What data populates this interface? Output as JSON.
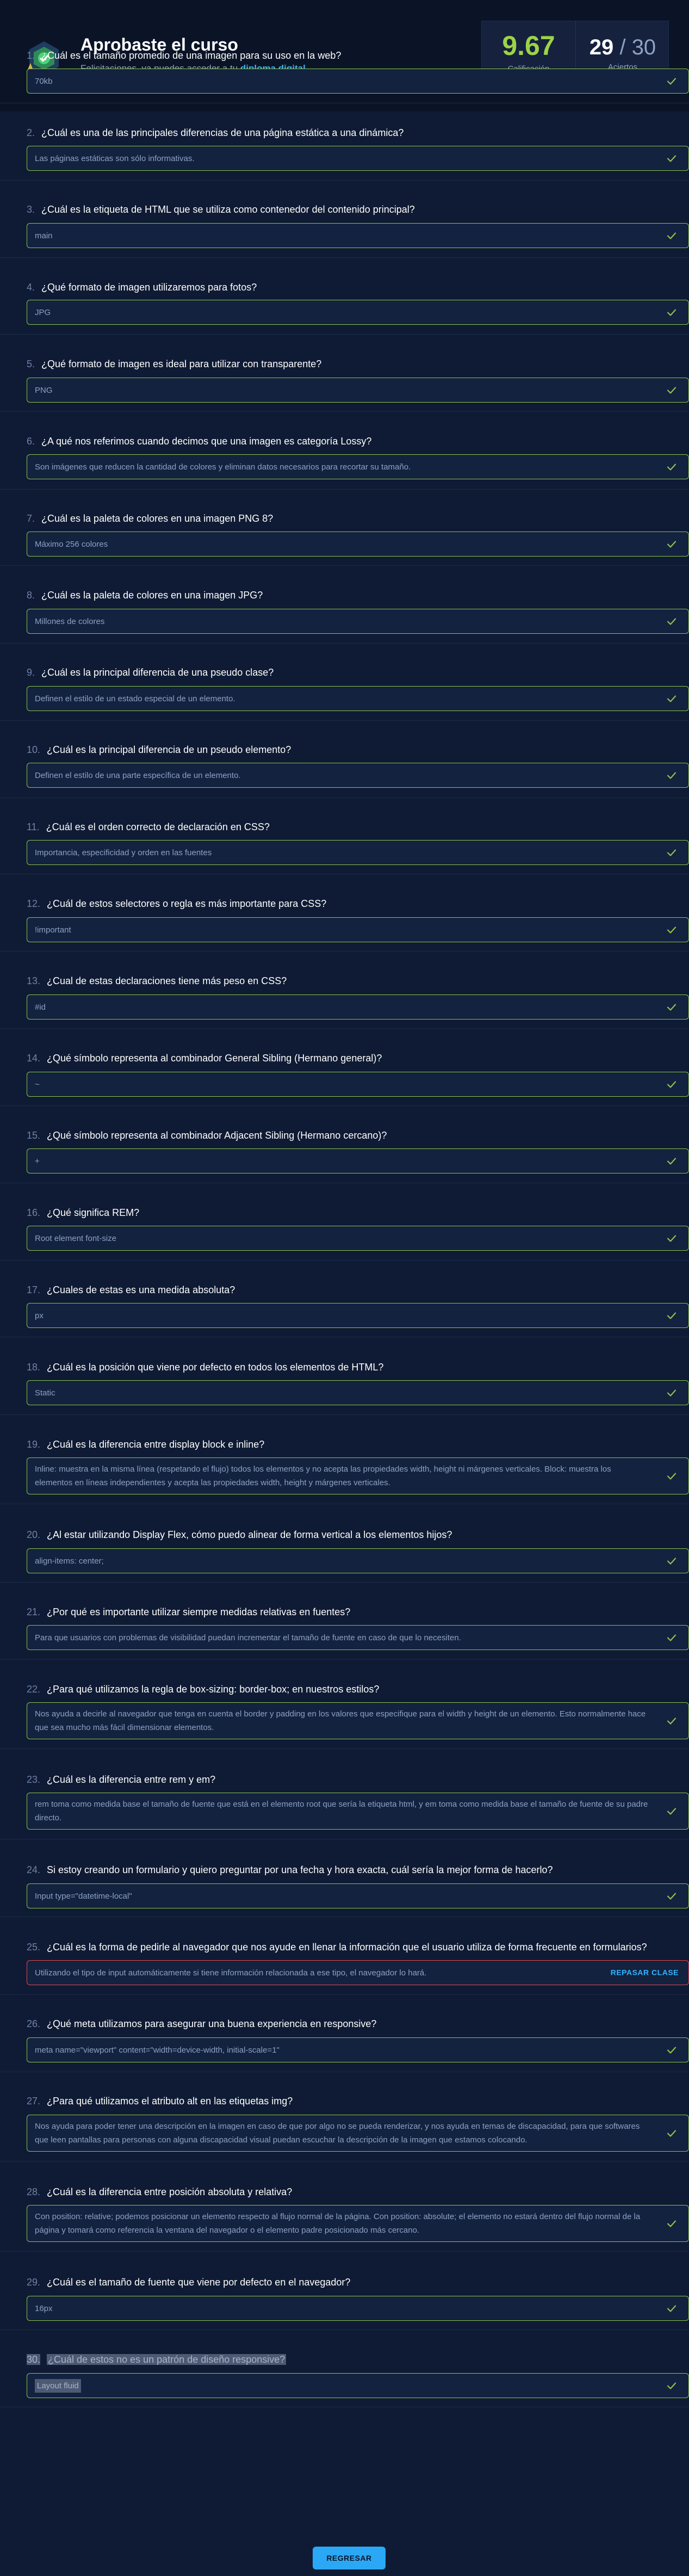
{
  "header": {
    "title": "Aprobaste el curso",
    "subtitle": "Felicitaciones, ya puedes acceder a tu",
    "diploma_link": "diploma digital",
    "grade": "9.67",
    "grade_label": "Calificación",
    "hits": "29",
    "hits_separator": "/",
    "hits_total": "30",
    "hits_label": "Aciertos"
  },
  "questions": [
    {
      "num": "1.",
      "q": "¿Cuál es el tamaño promedio de una imagen para su uso en la web?",
      "a": "70kb",
      "ok": true
    },
    {
      "num": "2.",
      "q": "¿Cuál es una de las principales diferencias de una página estática a una dinámica?",
      "a": "Las páginas estáticas son sólo informativas.",
      "ok": true
    },
    {
      "num": "3.",
      "q": "¿Cuál es la etiqueta de HTML que se utiliza como contenedor del contenido principal?",
      "a": "main",
      "ok": true
    },
    {
      "num": "4.",
      "q": "¿Qué formato de imagen utilizaremos para fotos?",
      "a": "JPG",
      "ok": true
    },
    {
      "num": "5.",
      "q": "¿Qué formato de imagen es ideal para utilizar con transparente?",
      "a": "PNG",
      "ok": true
    },
    {
      "num": "6.",
      "q": "¿A qué nos referimos cuando decimos que una imagen es categoría Lossy?",
      "a": "Son imágenes que reducen la cantidad de colores y eliminan datos necesarios para recortar su tamaño.",
      "ok": true
    },
    {
      "num": "7.",
      "q": "¿Cuál es la paleta de colores en una imagen PNG 8?",
      "a": "Máximo 256 colores",
      "ok": true
    },
    {
      "num": "8.",
      "q": "¿Cuál es la paleta de colores en una imagen JPG?",
      "a": "Millones de colores",
      "ok": true
    },
    {
      "num": "9.",
      "q": "¿Cuál es la principal diferencia de una pseudo clase?",
      "a": "Definen el estilo de un estado especial de un elemento.",
      "ok": true
    },
    {
      "num": "10.",
      "q": "¿Cuál es la principal diferencia de un pseudo elemento?",
      "a": "Definen el estilo de una parte específica de un elemento.",
      "ok": true
    },
    {
      "num": "11.",
      "q": "¿Cuál es el orden correcto de declaración en CSS?",
      "a": "Importancia, especificidad y orden en las fuentes",
      "ok": true
    },
    {
      "num": "12.",
      "q": "¿Cuál de estos selectores o regla es más importante para CSS?",
      "a": "!important",
      "ok": true
    },
    {
      "num": "13.",
      "q": "¿Cual de estas declaraciones tiene más peso en CSS?",
      "a": "#id",
      "ok": true
    },
    {
      "num": "14.",
      "q": "¿Qué símbolo representa al combinador General Sibling (Hermano general)?",
      "a": "~",
      "ok": true
    },
    {
      "num": "15.",
      "q": "¿Qué símbolo representa al combinador Adjacent Sibling (Hermano cercano)?",
      "a": "+",
      "ok": true
    },
    {
      "num": "16.",
      "q": "¿Qué significa REM?",
      "a": "Root element font-size",
      "ok": true
    },
    {
      "num": "17.",
      "q": "¿Cuales de estas es una medida absoluta?",
      "a": "px",
      "ok": true
    },
    {
      "num": "18.",
      "q": "¿Cuál es la posición que viene por defecto en todos los elementos de HTML?",
      "a": "Static",
      "ok": true
    },
    {
      "num": "19.",
      "q": "¿Cuál es la diferencia entre display block e inline?",
      "a": "Inline: muestra en la misma línea (respetando el flujo) todos los elementos y no acepta las propiedades width, height ni márgenes verticales. Block: muestra los elementos en líneas independientes y acepta las propiedades width, height y márgenes verticales.",
      "ok": true
    },
    {
      "num": "20.",
      "q": "¿Al estar utilizando Display Flex, cómo puedo alinear de forma vertical a los elementos hijos?",
      "a": "align-items: center;",
      "ok": true
    },
    {
      "num": "21.",
      "q": "¿Por qué es importante utilizar siempre medidas relativas en fuentes?",
      "a": "Para que usuarios con problemas de visibilidad puedan incrementar el tamaño de fuente en caso de que lo necesiten.",
      "ok": true
    },
    {
      "num": "22.",
      "q": "¿Para qué utilizamos la regla de box-sizing: border-box; en nuestros estilos?",
      "a": "Nos ayuda a decirle al navegador que tenga en cuenta el border y padding en los valores que especifique para el width y height de un elemento. Esto normalmente hace que sea mucho más fácil dimensionar elementos.",
      "ok": true
    },
    {
      "num": "23.",
      "q": "¿Cuál es la diferencia entre rem y em?",
      "a": "rem toma como medida base el tamaño de fuente que está en el elemento root que sería la etiqueta html, y em toma como medida base el tamaño de fuente de su padre directo.",
      "ok": true
    },
    {
      "num": "24.",
      "q": "Si estoy creando un formulario y quiero preguntar por una fecha y hora exacta, cuál sería la mejor forma de hacerlo?",
      "a": "Input type=\"datetime-local\"",
      "ok": true
    },
    {
      "num": "25.",
      "q": "¿Cuál es la forma de pedirle al navegador que nos ayude en llenar la información que el usuario utiliza de forma frecuente en formularios?",
      "a": "Utilizando el tipo de input automáticamente si tiene información relacionada a ese tipo, el navegador lo hará.",
      "ok": false,
      "review": "REPASAR CLASE"
    },
    {
      "num": "26.",
      "q": "¿Qué meta utilizamos para asegurar una buena experiencia en responsive?",
      "a": "meta name=\"viewport\" content=\"width=device-width, initial-scale=1\"",
      "ok": true
    },
    {
      "num": "27.",
      "q": "¿Para qué utilizamos el atributo alt en las etiquetas img?",
      "a": "Nos ayuda para poder tener una descripción en la imagen en caso de que por algo no se pueda renderizar, y nos ayuda en temas de discapacidad, para que softwares que leen pantallas para personas con alguna discapacidad visual puedan escuchar la descripción de la imagen que estamos colocando.",
      "ok": true
    },
    {
      "num": "28.",
      "q": "¿Cuál es la diferencia entre posición absoluta y relativa?",
      "a": "Con position: relative; podemos posicionar un elemento respecto al flujo normal de la página. Con position: absolute; el elemento no estará dentro del flujo normal de la página y tomará como referencia la ventana del navegador o el elemento padre posicionado más cercano.",
      "ok": true
    },
    {
      "num": "29.",
      "q": "¿Cuál es el tamaño de fuente que viene por defecto en el navegador?",
      "a": "16px",
      "ok": true
    },
    {
      "num": "30.",
      "q": "¿Cuál de estos no es un patrón de diseño responsive?",
      "a": "Layout fluid",
      "ok": true
    }
  ],
  "footer": {
    "return_label": "REGRESAR"
  }
}
